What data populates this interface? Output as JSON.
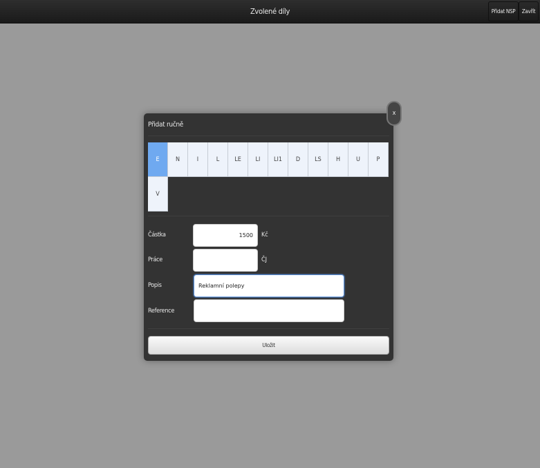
{
  "header": {
    "title": "Zvolené díly",
    "add_nsp_label": "Přidat NSP",
    "close_label": "Zavřít"
  },
  "dialog": {
    "title": "Přidat ručně",
    "close_label": "x",
    "categories": [
      {
        "label": "E",
        "selected": true
      },
      {
        "label": "N",
        "selected": false
      },
      {
        "label": "I",
        "selected": false
      },
      {
        "label": "L",
        "selected": false
      },
      {
        "label": "LE",
        "selected": false
      },
      {
        "label": "LI",
        "selected": false
      },
      {
        "label": "LI1",
        "selected": false
      },
      {
        "label": "D",
        "selected": false
      },
      {
        "label": "LS",
        "selected": false
      },
      {
        "label": "H",
        "selected": false
      },
      {
        "label": "U",
        "selected": false
      },
      {
        "label": "P",
        "selected": false
      },
      {
        "label": "V",
        "selected": false
      }
    ],
    "amount": {
      "label": "Částka",
      "value": "1500",
      "unit": "Kč"
    },
    "work": {
      "label": "Práce",
      "value": "",
      "unit": "ČJ"
    },
    "description": {
      "label": "Popis",
      "value": "Reklamní polepy"
    },
    "reference": {
      "label": "Reference",
      "value": ""
    },
    "submit_label": "Uložit"
  },
  "colors": {
    "background": "#9a9a9a",
    "dialog": "#333333",
    "selected_category": "#6fa9f0",
    "category": "#eef3fb"
  }
}
